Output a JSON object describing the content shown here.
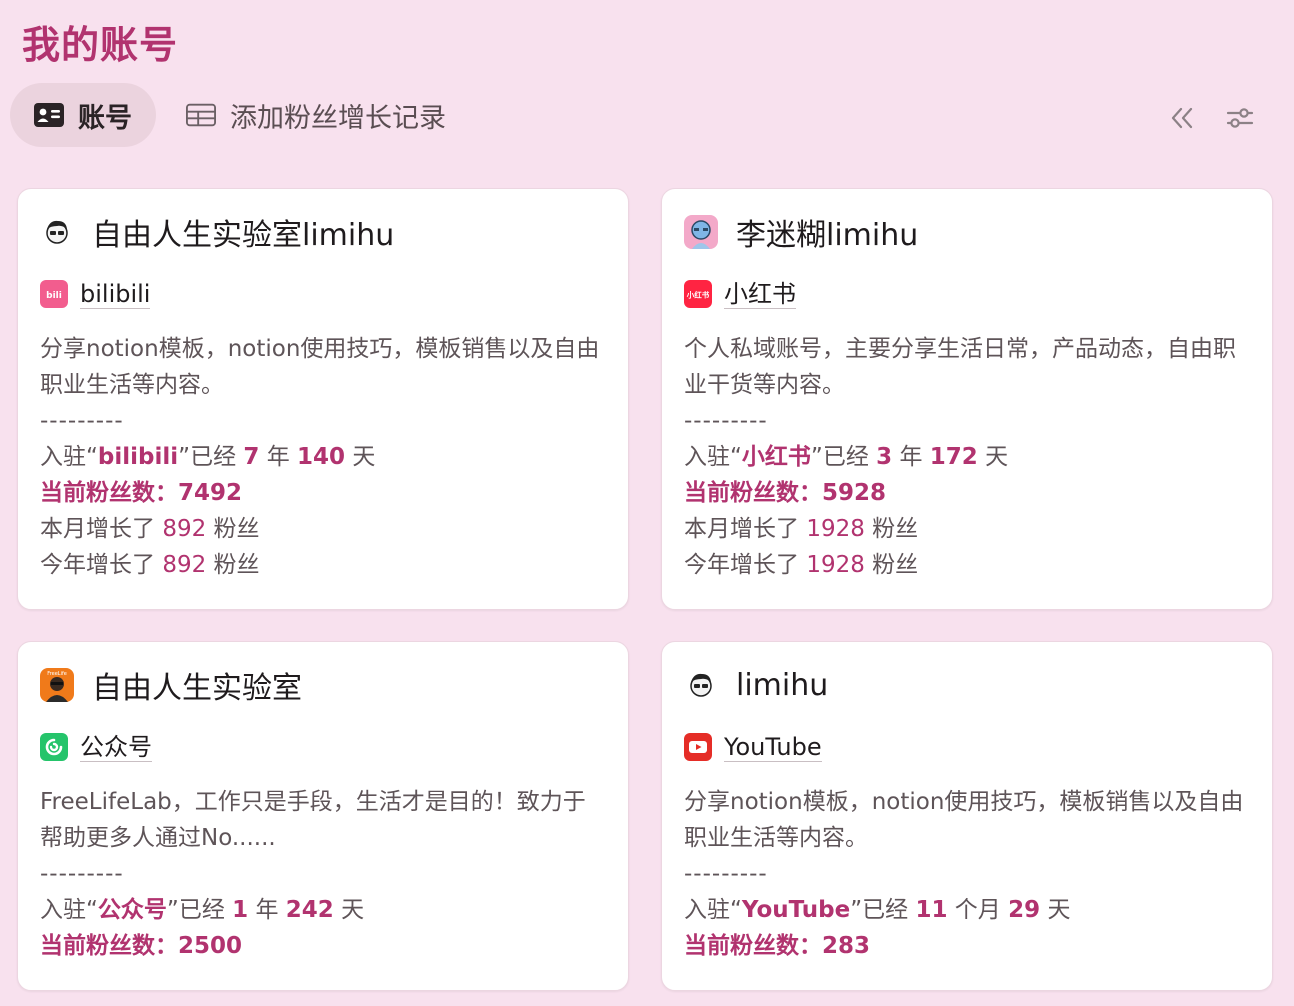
{
  "page": {
    "title": "我的账号"
  },
  "tabs": [
    {
      "label": "账号",
      "icon": "contact-card-icon",
      "active": true
    },
    {
      "label": "添加粉丝增长记录",
      "icon": "table-icon",
      "active": false
    }
  ],
  "toolbar": {
    "collapse_icon": "double-chevron-left-icon",
    "settings_icon": "sliders-icon"
  },
  "accent_color": "#b1336f",
  "cards": [
    {
      "name": "自由人生实验室limihu",
      "avatar": "cartoon-avatar-icon",
      "platform": "bilibili",
      "platform_icon": "bilibili-icon",
      "description": "分享notion模板，notion使用技巧，模板销售以及自由职业生活等内容。",
      "separator": "---------",
      "joined": {
        "prefix": "入驻“",
        "platform": "bilibili",
        "mid": "”已经 ",
        "v1": "7",
        "u1": " 年 ",
        "v2": "140",
        "u2": " 天"
      },
      "fans": {
        "label": "当前粉丝数：",
        "value": "7492"
      },
      "month": {
        "prefix": "本月增长了 ",
        "value": "892",
        "suffix": " 粉丝"
      },
      "year": {
        "prefix": "今年增长了 ",
        "value": "892",
        "suffix": " 粉丝"
      }
    },
    {
      "name": "李迷糊limihu",
      "avatar": "blue-cartoon-avatar-icon",
      "platform": "小红书",
      "platform_icon": "xiaohongshu-icon",
      "description": "个人私域账号，主要分享生活日常，产品动态，自由职业干货等内容。",
      "separator": "---------",
      "joined": {
        "prefix": "入驻“",
        "platform": "小红书",
        "mid": "”已经 ",
        "v1": "3",
        "u1": " 年 ",
        "v2": "172",
        "u2": " 天"
      },
      "fans": {
        "label": "当前粉丝数：",
        "value": "5928"
      },
      "month": {
        "prefix": "本月增长了 ",
        "value": "1928",
        "suffix": " 粉丝"
      },
      "year": {
        "prefix": "今年增长了 ",
        "value": "1928",
        "suffix": " 粉丝"
      }
    },
    {
      "name": "自由人生实验室",
      "avatar": "orange-freelife-avatar-icon",
      "platform": "公众号",
      "platform_icon": "wechat-official-icon",
      "description": "FreeLifeLab，工作只是手段，生活才是目的！致力于帮助更多人通过No......",
      "separator": "---------",
      "joined": {
        "prefix": "入驻“",
        "platform": "公众号",
        "mid": "”已经 ",
        "v1": "1",
        "u1": " 年 ",
        "v2": "242",
        "u2": " 天"
      },
      "fans": {
        "label": "当前粉丝数：",
        "value": "2500"
      }
    },
    {
      "name": "limihu",
      "avatar": "cartoon-avatar-icon",
      "platform": "YouTube",
      "platform_icon": "youtube-icon",
      "description": "分享notion模板，notion使用技巧，模板销售以及自由职业生活等内容。",
      "separator": "---------",
      "joined": {
        "prefix": "入驻“",
        "platform": "YouTube",
        "mid": "”已经 ",
        "v1": "11",
        "u1": " 个月 ",
        "v2": "29",
        "u2": " 天"
      },
      "fans": {
        "label": "当前粉丝数：",
        "value": "283"
      }
    }
  ]
}
